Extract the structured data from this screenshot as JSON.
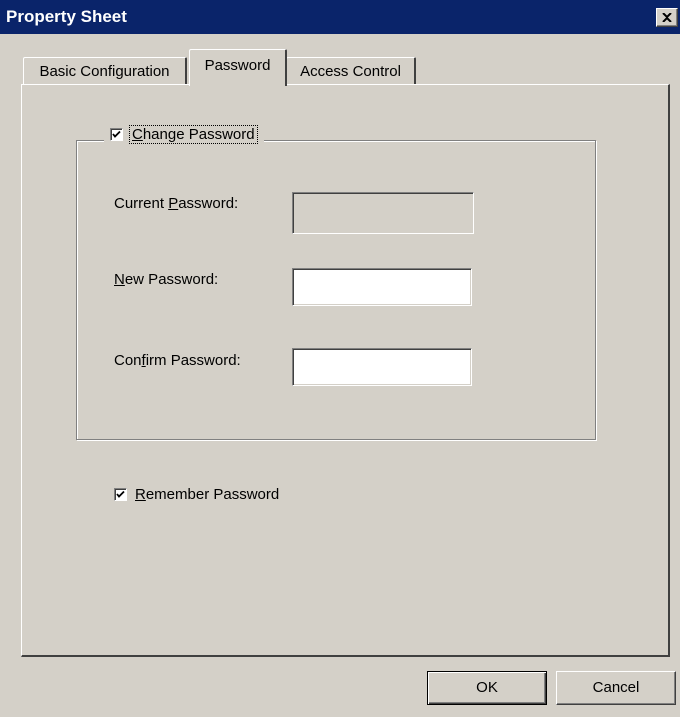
{
  "window": {
    "title": "Property Sheet"
  },
  "tabs": [
    {
      "label": "Basic Configuration",
      "selected": false
    },
    {
      "label": "Password",
      "selected": true
    },
    {
      "label": "Access Control",
      "selected": false
    }
  ],
  "group": {
    "checkbox_label_pre": "",
    "checkbox_label_mnemonic": "C",
    "checkbox_label_post": "hange Password",
    "checked": true
  },
  "fields": {
    "current": {
      "label_pre": "Current ",
      "mnemonic": "P",
      "label_post": "assword:",
      "value": "",
      "enabled": false
    },
    "new": {
      "label_pre": "",
      "mnemonic": "N",
      "label_post": "ew Password:",
      "value": "",
      "enabled": true
    },
    "confirm": {
      "label_pre": "Con",
      "mnemonic": "f",
      "label_post": "irm Password:",
      "value": "",
      "enabled": true
    }
  },
  "remember": {
    "label_pre": "",
    "mnemonic": "R",
    "label_post": "emember Password",
    "checked": true
  },
  "buttons": {
    "ok": "OK",
    "cancel": "Cancel"
  },
  "colors": {
    "titlebar": "#0a246a",
    "face": "#d4d0c8"
  }
}
